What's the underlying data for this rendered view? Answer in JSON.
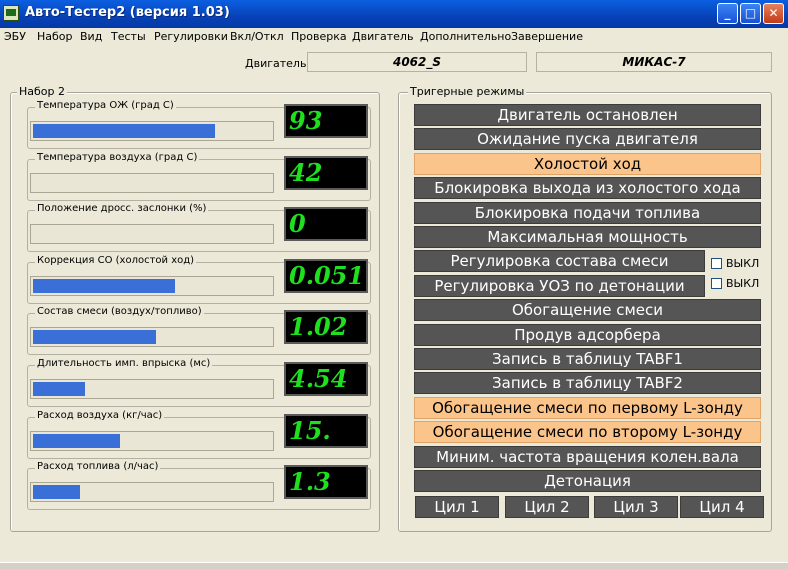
{
  "window": {
    "title": "Авто-Тестер2  (версия 1.03)",
    "minimize": "_",
    "maximize": "□",
    "close": "✕"
  },
  "menu": [
    "ЭБУ",
    "Набор",
    "Вид",
    "Тесты",
    "Регулировки",
    "Вкл/Откл",
    "Проверка",
    "Двигатель",
    "Дополнительно",
    "Завершение"
  ],
  "engine": {
    "label": "Двигатель",
    "model": "4062_S",
    "ecu": "МИКАС-7"
  },
  "set_group": {
    "title": "Набор 2",
    "params": [
      {
        "label": "Температура  ОЖ (град С)",
        "value": "93",
        "level": 0.77
      },
      {
        "label": "Температура  воздуха (град С)",
        "value": "42",
        "level": 0.0
      },
      {
        "label": "Положение дросс. заслонки (%)",
        "value": "0",
        "level": 0.0
      },
      {
        "label": "Коррекция СО (холостой ход)",
        "value": "0.051",
        "level": 0.6
      },
      {
        "label": "Состав смеси (воздух/топливо)",
        "value": "1.02",
        "level": 0.52
      },
      {
        "label": "Длительность имп. впрыска (мс)",
        "value": "4.54",
        "level": 0.22
      },
      {
        "label": "Расход воздуха (кг/час)",
        "value": "15.",
        "level": 0.37
      },
      {
        "label": "Расход топлива (л/час)",
        "value": "1.3",
        "level": 0.2
      }
    ]
  },
  "trigger_group": {
    "title": "Тригерные режимы",
    "modes": [
      {
        "label": "Двигатель остановлен",
        "active": false
      },
      {
        "label": "Ожидание пуска двигателя",
        "active": false
      },
      {
        "label": "Холостой ход",
        "active": true
      },
      {
        "label": "Блокировка выхода из холостого хода",
        "active": false
      },
      {
        "label": "Блокировка подачи топлива",
        "active": false
      },
      {
        "label": "Максимальная мощность",
        "active": false
      },
      {
        "label": "Регулировка состава смеси",
        "active": false
      },
      {
        "label": "Регулировка УОЗ по детонации",
        "active": false
      },
      {
        "label": "Обогащение смеси",
        "active": false
      },
      {
        "label": "Продув адсорбера",
        "active": false
      },
      {
        "label": "Запись в таблицу TABF1",
        "active": false
      },
      {
        "label": "Запись в таблицу TABF2",
        "active": false
      },
      {
        "label": "Обогащение смеси по первому L-зонду",
        "active": true
      },
      {
        "label": "Обогащение смеси по второму L-зонду",
        "active": true
      },
      {
        "label": "Миним. частота вращения колен.вала",
        "active": false
      },
      {
        "label": "Детонация",
        "active": false
      }
    ],
    "checkboxes": [
      {
        "label": "ВЫКЛ",
        "checked": false
      },
      {
        "label": "ВЫКЛ",
        "checked": false
      }
    ],
    "cylinders": [
      "Цил 1",
      "Цил 2",
      "Цил 3",
      "Цил 4"
    ]
  },
  "colors": {
    "titlebar": "#0742b8",
    "bar_fill": "#3a6fd8",
    "lcd_text": "#1fe01f",
    "mode_inactive": "#555555",
    "mode_active": "#fbc48a"
  }
}
